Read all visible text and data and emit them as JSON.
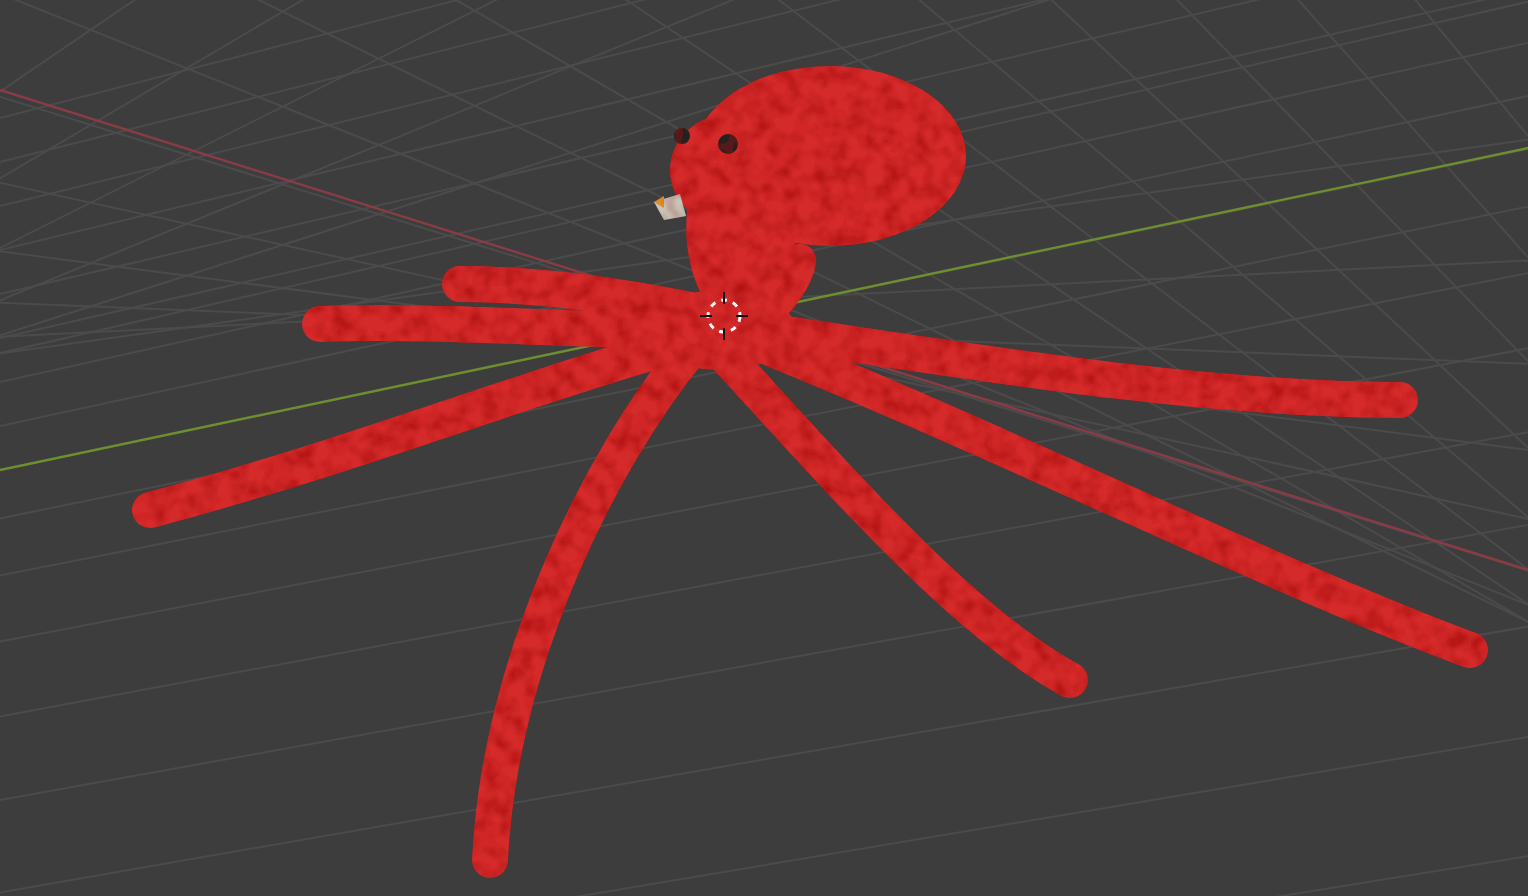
{
  "viewport": {
    "grid": true,
    "axes": true,
    "cursor": true
  }
}
